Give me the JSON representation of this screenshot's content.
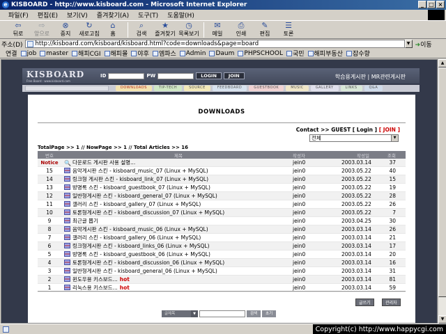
{
  "window": {
    "title": "KISBOARD - http://www.kisboard.com - Microsoft Internet Explorer"
  },
  "menu": [
    "파일(F)",
    "편집(E)",
    "보기(V)",
    "즐겨찾기(A)",
    "도구(T)",
    "도움말(H)"
  ],
  "toolbar": [
    {
      "label": "뒤로",
      "icon": "back-arrow",
      "disabled": false
    },
    {
      "label": "앞으로",
      "icon": "forward-arrow",
      "disabled": true
    },
    {
      "label": "중지",
      "icon": "stop",
      "disabled": false
    },
    {
      "label": "새로고침",
      "icon": "refresh",
      "disabled": false
    },
    {
      "label": "홈",
      "icon": "home",
      "disabled": false
    },
    {
      "label": "검색",
      "icon": "search",
      "disabled": false
    },
    {
      "label": "즐겨찾기",
      "icon": "favorites",
      "disabled": false
    },
    {
      "label": "목록보기",
      "icon": "history",
      "disabled": false
    },
    {
      "label": "메일",
      "icon": "mail",
      "disabled": false
    },
    {
      "label": "인쇄",
      "icon": "print",
      "disabled": false
    },
    {
      "label": "편집",
      "icon": "edit",
      "disabled": false
    },
    {
      "label": "토론",
      "icon": "discuss",
      "disabled": false
    }
  ],
  "address": {
    "label": "주소(D)",
    "url": "http://kisboard.com/kisboard/kisboard.html?code=downloads&page=board",
    "go_label": "이동"
  },
  "links": {
    "label": "연결",
    "items": [
      "job",
      "master",
      "해피CGI",
      "해피몰",
      "야후",
      "엠파스",
      "Admin",
      "Daum",
      "PHPSCHOOL",
      "국민",
      "해피부동산",
      "잡수향"
    ]
  },
  "site": {
    "logo": "KISBOARD",
    "logo_sub": "Free Board · www.kisboard.com",
    "id_label": "ID",
    "pw_label": "PW",
    "login_button": "LOGIN",
    "join_button": "JOIN",
    "header_links": "학습용게시판 | MR관련게시판",
    "nav": [
      {
        "label": "DOWNLOADS",
        "color": "#f3e3b0",
        "active": true
      },
      {
        "label": "TIP-TECH",
        "color": "#cfe7c4",
        "active": false
      },
      {
        "label": "SOURCE",
        "color": "#f2e8b8",
        "active": false
      },
      {
        "label": "FEEDBOARD",
        "color": "#d7e2ee",
        "active": false
      },
      {
        "label": "GUESTBOOK",
        "color": "#f0d2d2",
        "active": false
      },
      {
        "label": "MUSIC",
        "color": "#efe6c7",
        "active": false
      },
      {
        "label": "GALLERY",
        "color": "#e0e0ec",
        "active": false
      },
      {
        "label": "LINKS",
        "color": "#d8e8d8",
        "active": false
      },
      {
        "label": "Q&A",
        "color": "#cfdbea",
        "active": false
      }
    ]
  },
  "board": {
    "title": "DOWNLOADS",
    "contact": {
      "prefix": "Contact >> ",
      "user": "GUEST",
      "login": "[ Login ]",
      "join": "[ JOIN ]"
    },
    "category": "전체",
    "stats": "TotalPage >> 1 // NowPage >> 1 // Total Articles >> 16",
    "columns": {
      "num": "번호",
      "subject": "제목",
      "name": "작성자",
      "date": "작성일",
      "hits": "조회"
    },
    "rows": [
      {
        "num": "Notice",
        "subject": "다운로드 게시판 사용 설명...",
        "name": "jein0",
        "date": "2003.03.14",
        "hits": "37",
        "notice": true,
        "hot": false
      },
      {
        "num": "15",
        "subject": "음악게시판 스킨 - kisboard_music_07 (Linux + MySQL)",
        "name": "jein0",
        "date": "2003.05.22",
        "hits": "40",
        "notice": false,
        "hot": false
      },
      {
        "num": "14",
        "subject": "링크형 게시판 스킨 - kisboard_link_07 (Linux + MySQL)",
        "name": "jein0",
        "date": "2003.05.22",
        "hits": "15",
        "notice": false,
        "hot": false
      },
      {
        "num": "13",
        "subject": "방명록 스킨 - kisboard_guestbook_07 (Linux + MySQL)",
        "name": "jein0",
        "date": "2003.05.22",
        "hits": "19",
        "notice": false,
        "hot": false
      },
      {
        "num": "12",
        "subject": "일반형게시판 스킨 - kisboard_general_07 (Linux + MySQL)",
        "name": "jein0",
        "date": "2003.05.22",
        "hits": "28",
        "notice": false,
        "hot": false
      },
      {
        "num": "11",
        "subject": "갤러리 스킨 - kisboard_gallery_07 (Linux + MySQL)",
        "name": "jein0",
        "date": "2003.05.22",
        "hits": "26",
        "notice": false,
        "hot": false
      },
      {
        "num": "10",
        "subject": "토론형게시판 스킨 - kisboard_discussion_07 (Linux + MySQL)",
        "name": "jein0",
        "date": "2003.05.22",
        "hits": "7",
        "notice": false,
        "hot": false
      },
      {
        "num": "9",
        "subject": "최근글 뽑기",
        "name": "jein0",
        "date": "2003.04.25",
        "hits": "30",
        "notice": false,
        "hot": false
      },
      {
        "num": "8",
        "subject": "음악게시판 스킨 - kisboard_music_06 (Linux + MySQL)",
        "name": "jein0",
        "date": "2003.03.14",
        "hits": "26",
        "notice": false,
        "hot": false
      },
      {
        "num": "7",
        "subject": "갤러리 스킨 - kisboard_gallery_06 (Linux + MySQL)",
        "name": "jein0",
        "date": "2003.03.14",
        "hits": "21",
        "notice": false,
        "hot": false
      },
      {
        "num": "6",
        "subject": "링크형게시판 스킨 - kisboard_links_06 (Linux + MySQL)",
        "name": "jein0",
        "date": "2003.03.14",
        "hits": "17",
        "notice": false,
        "hot": false
      },
      {
        "num": "5",
        "subject": "방명록 스킨 - kisboard_guestbook_06 (Linux + MySQL)",
        "name": "jein0",
        "date": "2003.03.14",
        "hits": "20",
        "notice": false,
        "hot": false
      },
      {
        "num": "4",
        "subject": "토론형게시판 스킨 - kisboard_discussion_06 (Linux + MySQL)",
        "name": "jein0",
        "date": "2003.03.14",
        "hits": "16",
        "notice": false,
        "hot": false
      },
      {
        "num": "3",
        "subject": "일반형게시판 스킨 - kisboard_general_06 (Linux + MySQL)",
        "name": "jein0",
        "date": "2003.03.14",
        "hits": "31",
        "notice": false,
        "hot": false
      },
      {
        "num": "2",
        "subject": "윈도우용 키스보드...",
        "name": "jein0",
        "date": "2003.03.14",
        "hits": "81",
        "notice": false,
        "hot": true
      },
      {
        "num": "1",
        "subject": "리눅스용 키스보드...",
        "name": "jein0",
        "date": "2003.03.14",
        "hits": "59",
        "notice": false,
        "hot": true
      }
    ],
    "hot_label": "hot",
    "write_button": "글쓰기",
    "manage_button": "관리자",
    "search_field": "글제목",
    "search_button": "검색",
    "reset_button": "초기"
  },
  "status": {
    "copyright": "Copyright(c) http://www.happycgi.com"
  }
}
